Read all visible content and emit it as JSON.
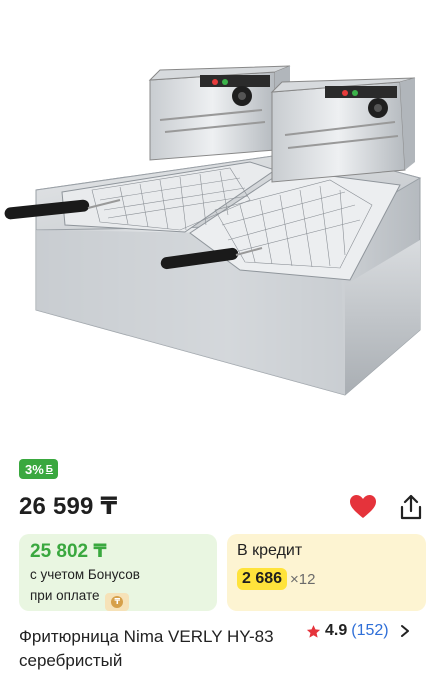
{
  "product": {
    "image_alt": "Фритюрница Nima VERLY HY-83",
    "bonus_percent": "3%",
    "bonus_mark": "Б",
    "price": "26 599 ₸",
    "bonus_card": {
      "price": "25 802 ₸",
      "line1": "с учетом Бонусов",
      "line2": "при оплате"
    },
    "credit": {
      "title": "В кредит",
      "amount": "2 686",
      "months": "×12"
    },
    "title": "Фритюрница Nima VERLY HY-83 серебристый",
    "rating": "4.9",
    "reviews": "(152)"
  },
  "colors": {
    "accent_green": "#3aa83f",
    "heart_red": "#e5333b",
    "credit_yellow": "#ffe33b",
    "link_blue": "#2f6fd8"
  },
  "icons": [
    "heart-icon",
    "share-icon",
    "star-icon",
    "chevron-right-icon",
    "coin-icon"
  ]
}
